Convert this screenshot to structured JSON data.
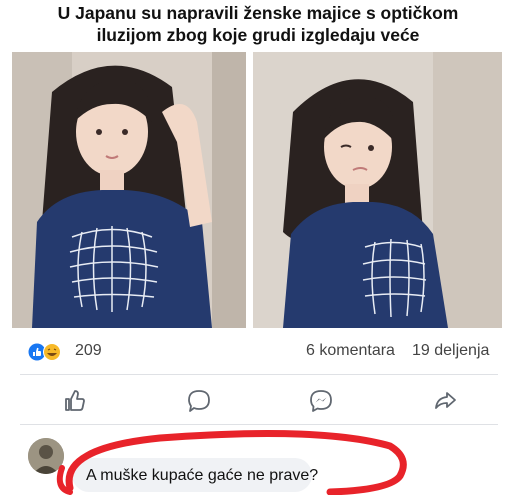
{
  "headline": {
    "line1": "U Japanu su napravili ženske majice s optičkom",
    "line2": "iluzijom zbog koje grudi izgledaju veće"
  },
  "reactions": {
    "like_count": "209",
    "comments_count": "6 komentara",
    "shares_count": "19 deljenja"
  },
  "comment": {
    "text": "A muške kupaće gaće ne prave?"
  },
  "colors": {
    "like_blue": "#1877f2",
    "haha_yellow": "#f7b928",
    "highlight_red": "#e8232a",
    "icon_gray": "#606770",
    "shirt_navy": "#253a6e"
  }
}
